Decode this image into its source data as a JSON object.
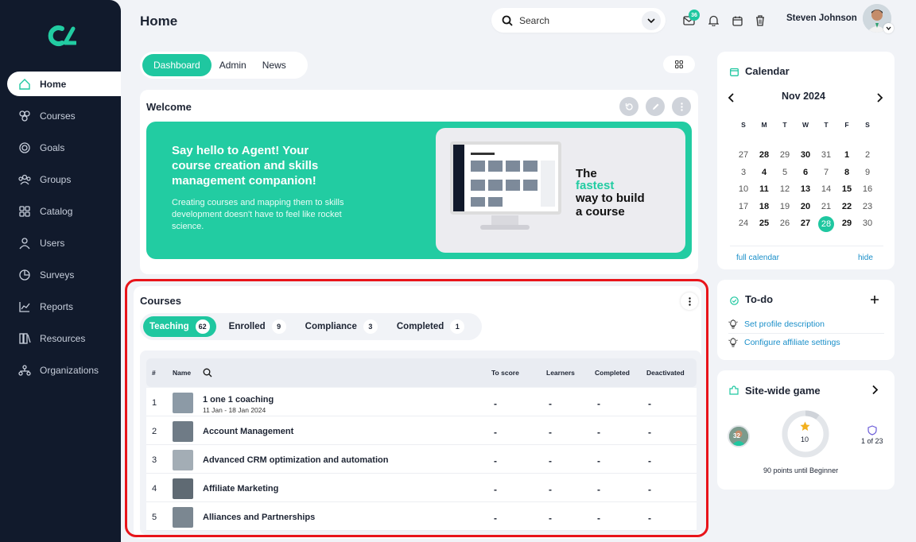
{
  "sidebar": {
    "items": [
      {
        "label": "Home",
        "icon": "home-icon"
      },
      {
        "label": "Courses",
        "icon": "courses-icon"
      },
      {
        "label": "Goals",
        "icon": "goals-icon"
      },
      {
        "label": "Groups",
        "icon": "groups-icon"
      },
      {
        "label": "Catalog",
        "icon": "catalog-icon"
      },
      {
        "label": "Users",
        "icon": "users-icon"
      },
      {
        "label": "Surveys",
        "icon": "surveys-icon"
      },
      {
        "label": "Reports",
        "icon": "reports-icon"
      },
      {
        "label": "Resources",
        "icon": "resources-icon"
      },
      {
        "label": "Organizations",
        "icon": "organizations-icon"
      }
    ]
  },
  "header": {
    "title": "Home",
    "search_placeholder": "Search",
    "message_badge": "36",
    "user_name": "Steven Johnson"
  },
  "dashboard_tabs": [
    "Dashboard",
    "Admin",
    "News"
  ],
  "welcome": {
    "title": "Welcome",
    "headline": "Say hello to Agent! Your course creation and skills management companion!",
    "body": "Creating courses and mapping them to skills development doesn't have to feel like rocket science.",
    "promo_line1": "The",
    "promo_line2": "fastest",
    "promo_line3": "way to build",
    "promo_line4": "a course"
  },
  "courses": {
    "title": "Courses",
    "tabs": [
      {
        "label": "Teaching",
        "count": "62"
      },
      {
        "label": "Enrolled",
        "count": "9"
      },
      {
        "label": "Compliance",
        "count": "3"
      },
      {
        "label": "Completed",
        "count": "1"
      }
    ],
    "columns": {
      "num": "#",
      "name": "Name",
      "to_score": "To score",
      "learners": "Learners",
      "completed": "Completed",
      "deactivated": "Deactivated"
    },
    "rows": [
      {
        "num": "1",
        "name": "1 one 1 coaching",
        "dates": "11 Jan - 18 Jan 2024",
        "to_score": "-",
        "learners": "-",
        "completed": "-",
        "deactivated": "-"
      },
      {
        "num": "2",
        "name": "Account Management",
        "dates": "",
        "to_score": "-",
        "learners": "-",
        "completed": "-",
        "deactivated": "-"
      },
      {
        "num": "3",
        "name": "Advanced CRM optimization and automation",
        "dates": "",
        "to_score": "-",
        "learners": "-",
        "completed": "-",
        "deactivated": "-"
      },
      {
        "num": "4",
        "name": "Affiliate Marketing",
        "dates": "",
        "to_score": "-",
        "learners": "-",
        "completed": "-",
        "deactivated": "-"
      },
      {
        "num": "5",
        "name": "Alliances and Partnerships",
        "dates": "",
        "to_score": "-",
        "learners": "-",
        "completed": "-",
        "deactivated": "-"
      }
    ]
  },
  "calendar": {
    "title": "Calendar",
    "month": "Nov 2024",
    "dow": [
      "S",
      "M",
      "T",
      "W",
      "T",
      "F",
      "S"
    ],
    "weeks": [
      [
        "27",
        "28",
        "29",
        "30",
        "31",
        "1",
        "2"
      ],
      [
        "3",
        "4",
        "5",
        "6",
        "7",
        "8",
        "9"
      ],
      [
        "10",
        "11",
        "12",
        "13",
        "14",
        "15",
        "16"
      ],
      [
        "17",
        "18",
        "19",
        "20",
        "21",
        "22",
        "23"
      ],
      [
        "24",
        "25",
        "26",
        "27",
        "28",
        "29",
        "30"
      ]
    ],
    "bold_columns": [
      1,
      3,
      5
    ],
    "today": "28",
    "full_calendar": "full calendar",
    "hide": "hide"
  },
  "todo": {
    "title": "To-do",
    "items": [
      "Set profile description",
      "Configure affiliate settings"
    ]
  },
  "game": {
    "title": "Site-wide game",
    "level": "32",
    "points": "10",
    "rank": "1 of 23",
    "progress_text": "90 points until Beginner"
  },
  "colors": {
    "accent": "#1fc7a0",
    "sidebar": "#111a2c",
    "highlight": "#e8141a",
    "link": "#1a8fc9"
  }
}
